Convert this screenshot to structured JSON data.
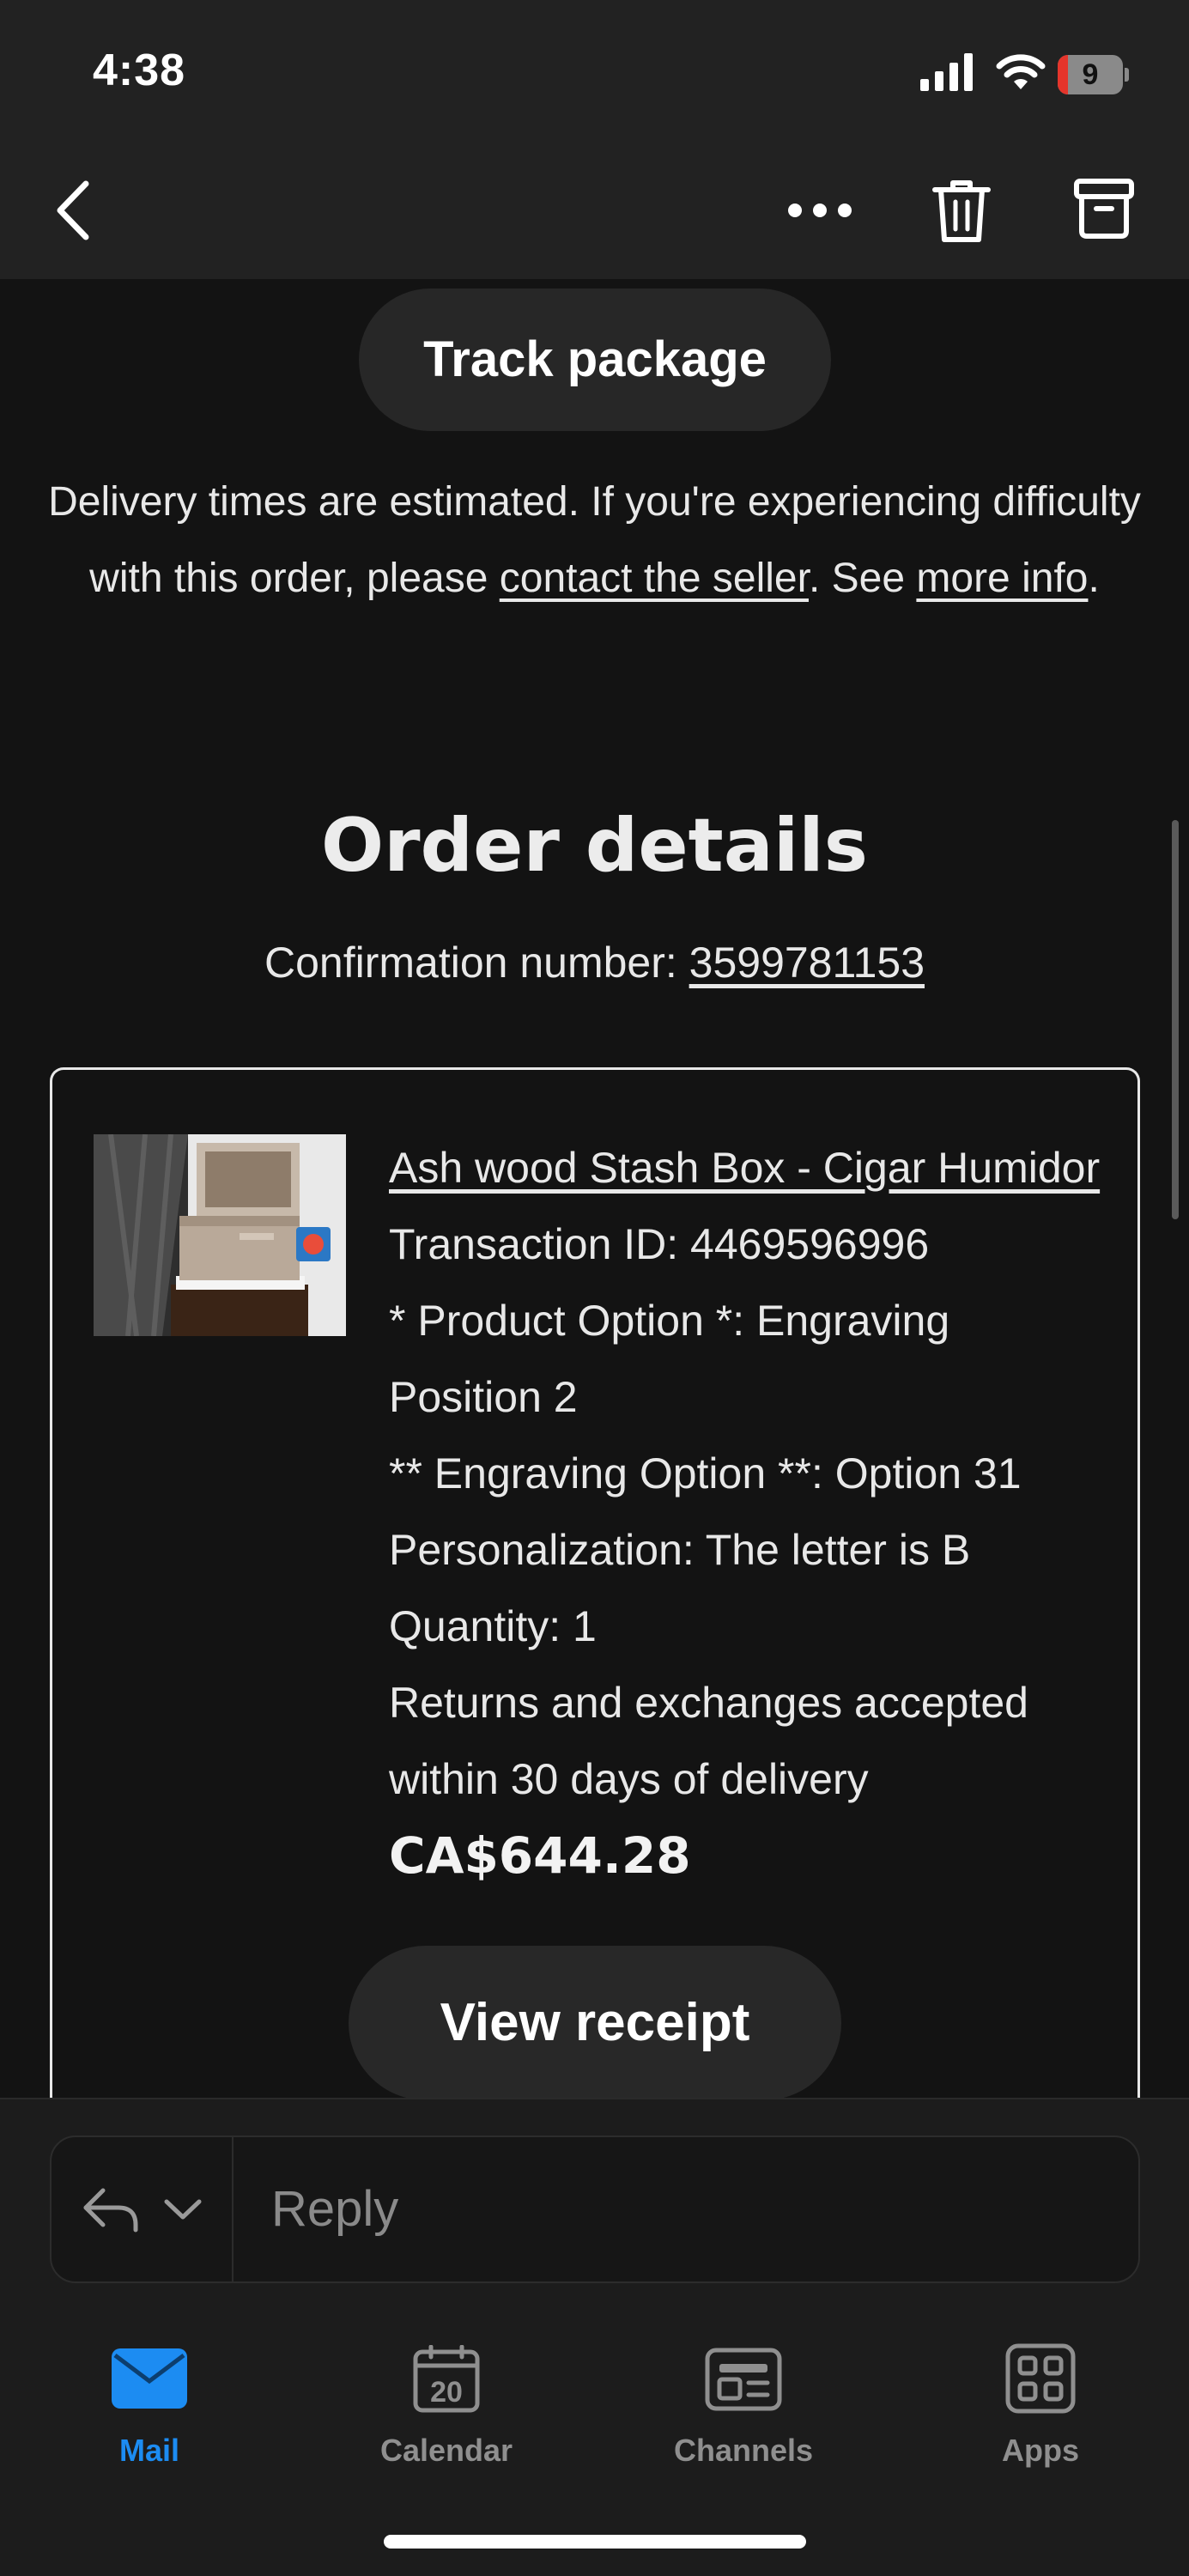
{
  "status_bar": {
    "time": "4:38",
    "battery_level": "9"
  },
  "header": {
    "back_icon": "chevron-left-icon",
    "more_icon": "more-horizontal-icon",
    "delete_icon": "trash-icon",
    "archive_icon": "archive-icon"
  },
  "email": {
    "track_button": "Track package",
    "delivery_text_1": "Delivery times are estimated. If you're experiencing difficulty with this order, please ",
    "contact_link": "contact the seller",
    "delivery_text_2": ". See ",
    "more_info_link": "more info",
    "delivery_text_3": ".",
    "order_title": "Order details",
    "confirmation_label": "Confirmation number: ",
    "confirmation_number": "3599781153",
    "item": {
      "title": "Ash wood Stash Box - Cigar Humidor",
      "transaction": "Transaction ID: 4469596996",
      "option_1": "* Product Option *: Engraving Position 2",
      "option_2": "** Engraving Option **: Option 31",
      "personalization": "Personalization: The letter is B",
      "quantity": "Quantity: 1",
      "returns": "Returns and exchanges accepted within 30 days of delivery",
      "price": "CA$644.28"
    },
    "receipt_button": "View receipt"
  },
  "reply": {
    "placeholder": "Reply"
  },
  "tabs": [
    {
      "label": "Mail",
      "icon": "mail-icon",
      "active": true
    },
    {
      "label": "Calendar",
      "icon": "calendar-icon",
      "day": "20"
    },
    {
      "label": "Channels",
      "icon": "channels-icon"
    },
    {
      "label": "Apps",
      "icon": "apps-grid-icon"
    }
  ],
  "colors": {
    "accent": "#1c8cf2",
    "background": "#131313",
    "header": "#222222",
    "battery_low": "#e5352b"
  }
}
